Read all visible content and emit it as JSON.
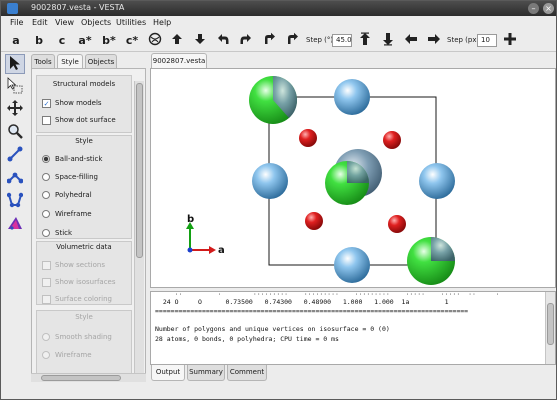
{
  "window": {
    "title": "9002807.vesta - VESTA",
    "minimize": "–",
    "close": "×"
  },
  "menu": [
    "File",
    "Edit",
    "View",
    "Objects",
    "Utilities",
    "Help"
  ],
  "toolbar": {
    "axis_buttons": [
      "a",
      "b",
      "c",
      "a*",
      "b*",
      "c*"
    ],
    "step_angle_label": "Step (°):",
    "step_angle_value": "45.0",
    "step_px_label": "Step (px):",
    "step_px_value": "10"
  },
  "left_tools": [
    "select-tool",
    "select-region-tool",
    "translate-tool",
    "magnify-tool",
    "distance-tool",
    "angle-tool",
    "dihedral-tool",
    "info-tool"
  ],
  "panel_tabs": [
    "Tools",
    "Style",
    "Objects"
  ],
  "panel_active_tab": "Style",
  "structural_models": {
    "heading": "Structural models",
    "show_models": "Show models",
    "show_models_checked": true,
    "show_dot_surface": "Show dot surface",
    "show_dot_surface_checked": false
  },
  "style_section": {
    "heading": "Style",
    "options": [
      "Ball-and-stick",
      "Space-filling",
      "Polyhedral",
      "Wireframe",
      "Stick"
    ],
    "selected": "Ball-and-stick"
  },
  "volumetric": {
    "heading": "Volumetric data",
    "show_sections": "Show sections",
    "show_isosurfaces": "Show isosurfaces",
    "surface_coloring": "Surface coloring"
  },
  "volumetric_style": {
    "heading": "Style",
    "options": [
      "Smooth shading",
      "Wireframe"
    ]
  },
  "file_tab": "9002807.vesta",
  "axes": {
    "b": "b",
    "a": "a"
  },
  "colors": {
    "oxygen": "#d61b1b",
    "blue_atom": "#63a9dc",
    "green_atom": "#2ed12e",
    "gray_atom": "#8aa6b8"
  },
  "output": {
    "partial_line": "     ··         ·        ·········    ·········    ·········    ·····    ·····  ··     ·",
    "row": "  24 O     O      0.73500   0.74300   0.48900   1.000   1.000  1a         1",
    "separator": "================================================================================",
    "line1": "Number of polygons and unique vertices on isosurface = 0 (0)",
    "line2": "28 atoms, 0 bonds, 0 polyhedra; CPU time = 0 ms"
  },
  "bottom_tabs": [
    "Output",
    "Summary",
    "Comment"
  ],
  "bottom_active_tab": "Output"
}
